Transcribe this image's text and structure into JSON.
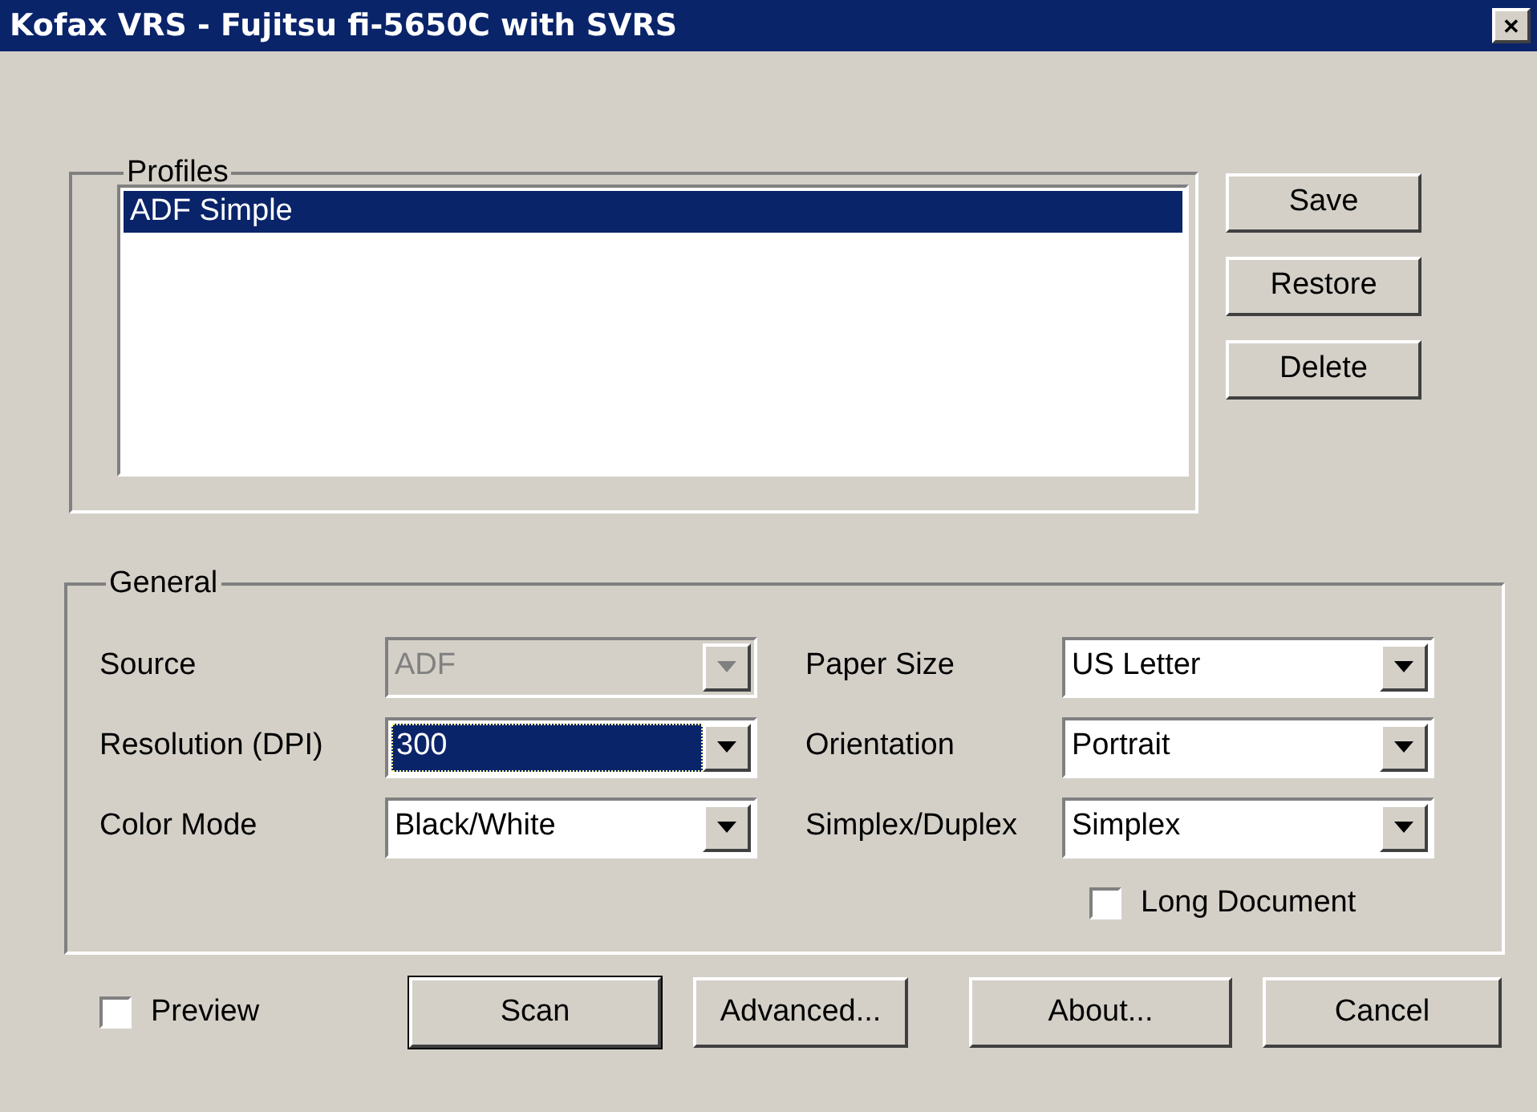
{
  "window": {
    "title": "Kofax VRS - Fujitsu fi-5650C with SVRS",
    "close": "✕"
  },
  "profiles": {
    "title": "Profiles",
    "items": [
      {
        "label": "ADF Simple",
        "selected": true
      }
    ],
    "buttons": [
      {
        "label": "Save"
      },
      {
        "label": "Restore"
      },
      {
        "label": "Delete"
      }
    ]
  },
  "general": {
    "title": "General",
    "fields": [
      {
        "label": "Source",
        "value": "ADF",
        "disabled": true,
        "focused": false
      },
      {
        "label": "Paper Size",
        "value": "US Letter",
        "disabled": false,
        "focused": false
      },
      {
        "label": "Resolution (DPI)",
        "value": "300",
        "disabled": false,
        "focused": true
      },
      {
        "label": "Orientation",
        "value": "Portrait",
        "disabled": false,
        "focused": false
      },
      {
        "label": "Color Mode",
        "value": "Black/White",
        "disabled": false,
        "focused": false
      },
      {
        "label": "Simplex/Duplex",
        "value": "Simplex",
        "disabled": false,
        "focused": false
      }
    ],
    "long_document": {
      "label": "Long Document",
      "checked": false
    }
  },
  "preview": {
    "label": "Preview",
    "checked": false
  },
  "buttons": [
    {
      "label": "Scan",
      "default": true
    },
    {
      "label": "Advanced...",
      "default": false
    },
    {
      "label": "About...",
      "default": false
    },
    {
      "label": "Cancel",
      "default": false
    }
  ]
}
